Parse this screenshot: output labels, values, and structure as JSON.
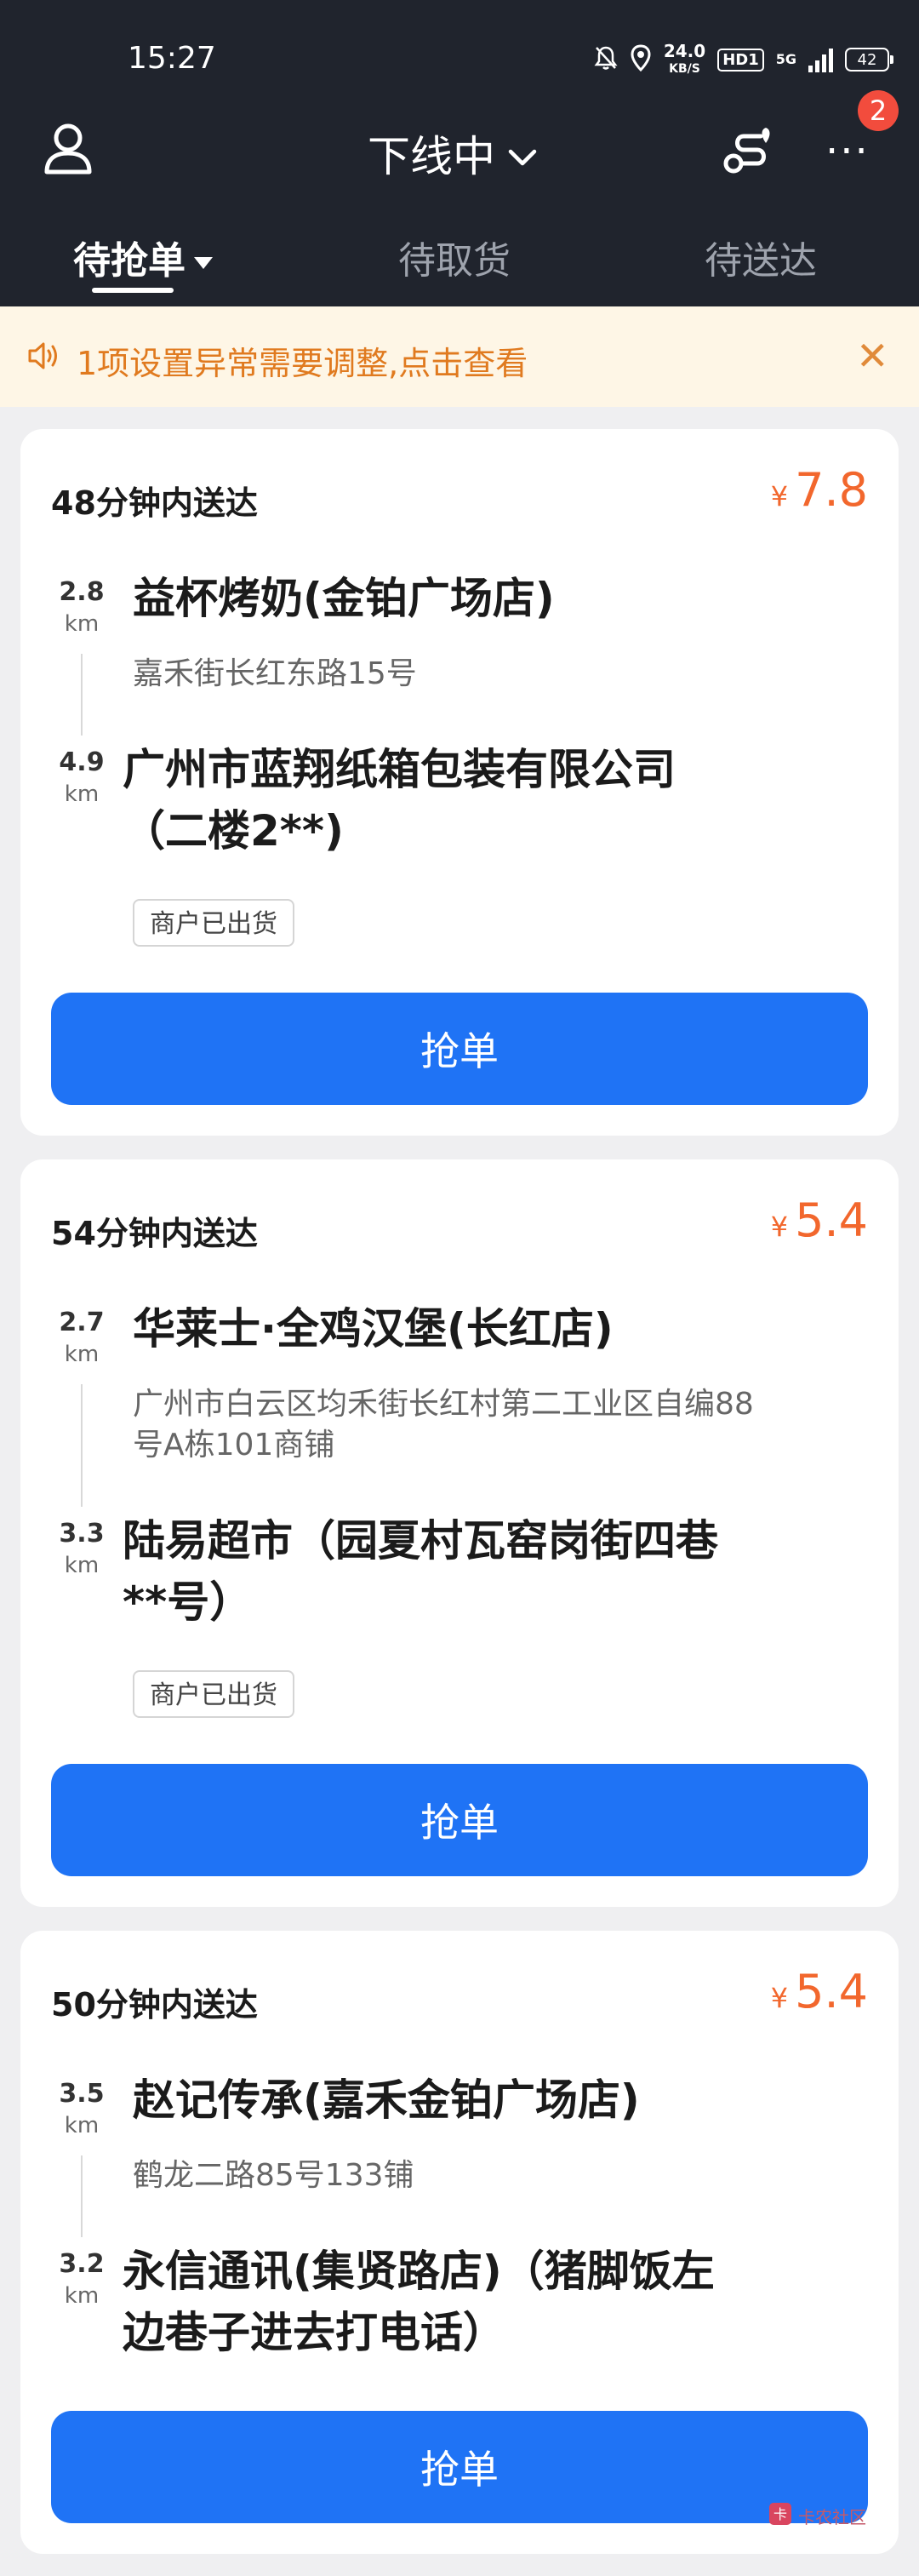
{
  "status_bar": {
    "time": "15:27",
    "net_speed_value": "24.0",
    "net_speed_unit": "KB/S",
    "hd_label": "HD1",
    "network_label": "5G",
    "battery": "42"
  },
  "nav": {
    "status_label": "下线中",
    "more_badge": "2"
  },
  "tabs": [
    {
      "label": "待抢单",
      "active": true
    },
    {
      "label": "待取货",
      "active": false
    },
    {
      "label": "待送达",
      "active": false
    }
  ],
  "notice": {
    "text": "1项设置异常需要调整,点击查看"
  },
  "currency_symbol": "¥",
  "distance_unit": "km",
  "orders": [
    {
      "deliver_time": "48分钟内送达",
      "price": "7.8",
      "pickup_distance": "2.8",
      "pickup_name": "益杯烤奶(金铂广场店)",
      "pickup_address": "嘉禾街长红东路15号",
      "drop_distance": "4.9",
      "drop_line1": "广州市蓝翔纸箱包装有限公司",
      "drop_line2": "（二楼2**)",
      "tag": "商户已出货",
      "button": "抢单"
    },
    {
      "deliver_time": "54分钟内送达",
      "price": "5.4",
      "pickup_distance": "2.7",
      "pickup_name": "华莱士·全鸡汉堡(长红店)",
      "pickup_address_line1": "广州市白云区均禾街长红村第二工业区自编88",
      "pickup_address_line2": "号A栋101商铺",
      "drop_distance": "3.3",
      "drop_line1": "陆易超市（园夏村瓦窑岗街四巷",
      "drop_line2": "**号）",
      "tag": "商户已出货",
      "button": "抢单"
    },
    {
      "deliver_time": "50分钟内送达",
      "price": "5.4",
      "pickup_distance": "3.5",
      "pickup_name": "赵记传承(嘉禾金铂广场店)",
      "pickup_address": "鹤龙二路85号133铺",
      "drop_distance": "3.2",
      "drop_line1": "永信通讯(集贤路店)（猪脚饭左",
      "drop_line2": "边巷子进去打电话）",
      "button": "抢单"
    }
  ],
  "watermark": "卡农社区"
}
